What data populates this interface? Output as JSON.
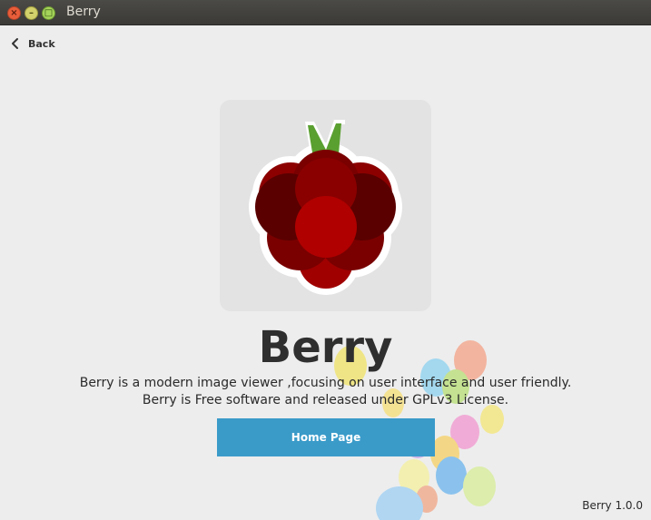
{
  "window": {
    "title": "Berry",
    "close_glyph": "×",
    "minimize_glyph": "–",
    "maximize_glyph": "□"
  },
  "nav": {
    "back_label": "Back"
  },
  "app": {
    "name": "Berry",
    "description_line1": "Berry is a modern image viewer ,focusing on user interface and user friendly.",
    "description_line2": "Berry is Free software and released under GPLv3 License.",
    "home_button_label": "Home Page",
    "version": "Berry 1.0.0"
  },
  "colors": {
    "accent": "#3a9bc9",
    "berry_dark": "#5e0000",
    "berry_mid": "#8a0000",
    "berry_light": "#b00000",
    "leaf": "#5aa030"
  },
  "icons": {
    "back": "chevron-left-icon",
    "logo": "raspberry-logo-icon",
    "decoration": "balloons-decoration"
  }
}
